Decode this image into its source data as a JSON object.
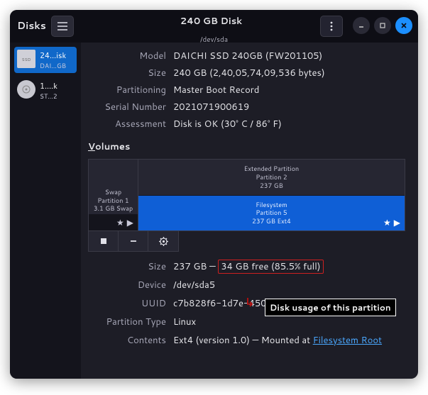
{
  "header": {
    "app_title": "Disks",
    "window_title": "240 GB Disk",
    "window_subtitle": "/dev/sda"
  },
  "sidebar": {
    "items": [
      {
        "line1": "24…isk",
        "line2": "DAI…GB",
        "icon_label": "SSD"
      },
      {
        "line1": "1.…k",
        "line2": "ST…2",
        "icon_label": ""
      }
    ]
  },
  "info": {
    "model_label": "Model",
    "model_value": "DAICHI SSD 240GB (FW201105)",
    "size_label": "Size",
    "size_value": "240 GB (2,40,05,74,09,536 bytes)",
    "partitioning_label": "Partitioning",
    "partitioning_value": "Master Boot Record",
    "serial_label": "Serial Number",
    "serial_value": "2021071900619",
    "assessment_label": "Assessment",
    "assessment_value": "Disk is OK (30° C / 86° F)"
  },
  "volumes": {
    "title_underline": "V",
    "title_rest": "olumes",
    "swap": {
      "name": "Swap",
      "partition": "Partition 1",
      "detail": "3.1 GB Swap"
    },
    "extended": {
      "name": "Extended Partition",
      "partition": "Partition 2",
      "detail": "237 GB"
    },
    "filesystem": {
      "name": "Filesystem",
      "partition": "Partition 5",
      "detail": "237 GB Ext4"
    }
  },
  "partition": {
    "size_label": "Size",
    "size_value_a": "237 GB — ",
    "size_value_b": "34 GB free (85.5% full)",
    "device_label": "Device",
    "device_value": "/dev/sda5",
    "uuid_label": "UUID",
    "uuid_value": "c7b828f6-1d7e-4506-9155-8182f56bd836",
    "type_label": "Partition Type",
    "type_value": "Linux",
    "contents_label": "Contents",
    "contents_prefix": "Ext4 (version 1.0) — Mounted at ",
    "contents_link": "Filesystem Root"
  },
  "annotation": {
    "text": "Disk usage of this partition"
  }
}
